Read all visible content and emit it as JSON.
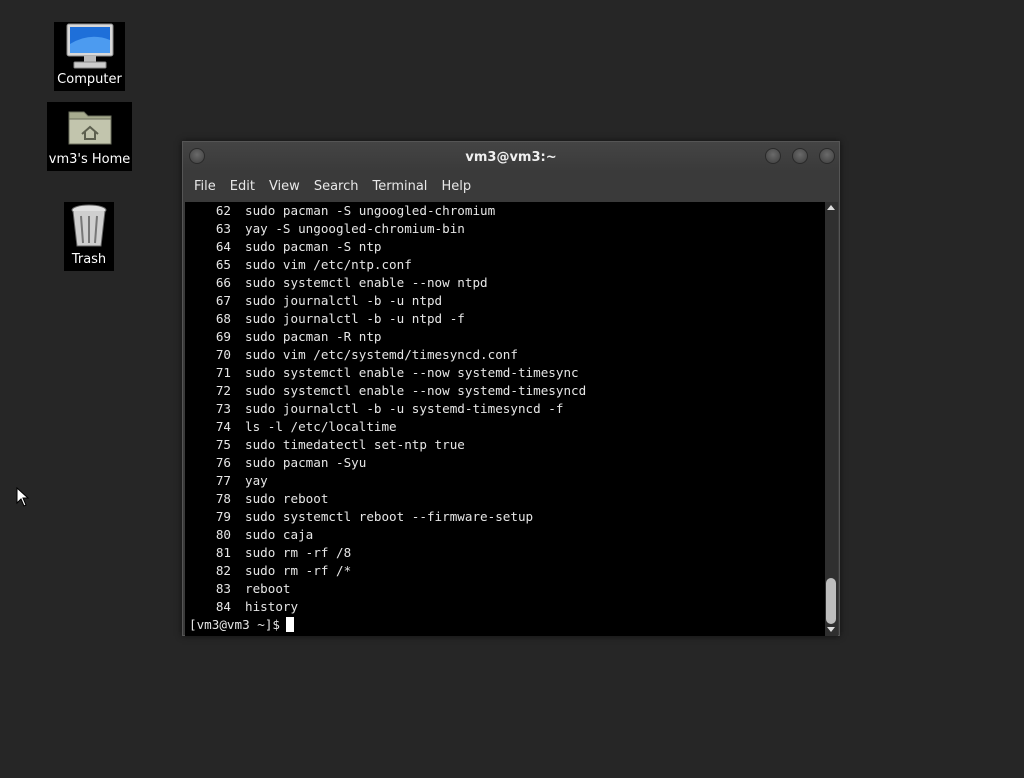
{
  "desktop": {
    "icons": [
      {
        "label": "Computer",
        "icon": "computer-icon"
      },
      {
        "label": "vm3's Home",
        "icon": "home-folder-icon"
      },
      {
        "label": "Trash",
        "icon": "trash-icon"
      }
    ]
  },
  "window": {
    "title": "vm3@vm3:~",
    "menu": [
      "File",
      "Edit",
      "View",
      "Search",
      "Terminal",
      "Help"
    ]
  },
  "terminal": {
    "history": [
      {
        "n": "62",
        "cmd": "sudo pacman -S ungoogled-chromium"
      },
      {
        "n": "63",
        "cmd": "yay -S ungoogled-chromium-bin"
      },
      {
        "n": "64",
        "cmd": "sudo pacman -S ntp"
      },
      {
        "n": "65",
        "cmd": "sudo vim /etc/ntp.conf"
      },
      {
        "n": "66",
        "cmd": "sudo systemctl enable --now ntpd"
      },
      {
        "n": "67",
        "cmd": "sudo journalctl -b -u ntpd"
      },
      {
        "n": "68",
        "cmd": "sudo journalctl -b -u ntpd -f"
      },
      {
        "n": "69",
        "cmd": "sudo pacman -R ntp"
      },
      {
        "n": "70",
        "cmd": "sudo vim /etc/systemd/timesyncd.conf"
      },
      {
        "n": "71",
        "cmd": "sudo systemctl enable --now systemd-timesync"
      },
      {
        "n": "72",
        "cmd": "sudo systemctl enable --now systemd-timesyncd"
      },
      {
        "n": "73",
        "cmd": "sudo journalctl -b -u systemd-timesyncd -f"
      },
      {
        "n": "74",
        "cmd": "ls -l /etc/localtime"
      },
      {
        "n": "75",
        "cmd": "sudo timedatectl set-ntp true"
      },
      {
        "n": "76",
        "cmd": "sudo pacman -Syu"
      },
      {
        "n": "77",
        "cmd": "yay"
      },
      {
        "n": "78",
        "cmd": "sudo reboot"
      },
      {
        "n": "79",
        "cmd": "sudo systemctl reboot --firmware-setup"
      },
      {
        "n": "80",
        "cmd": "sudo caja"
      },
      {
        "n": "81",
        "cmd": "sudo rm -rf /8"
      },
      {
        "n": "82",
        "cmd": "sudo rm -rf /*"
      },
      {
        "n": "83",
        "cmd": "reboot"
      },
      {
        "n": "84",
        "cmd": "history"
      }
    ],
    "prompt": "[vm3@vm3 ~]$"
  }
}
